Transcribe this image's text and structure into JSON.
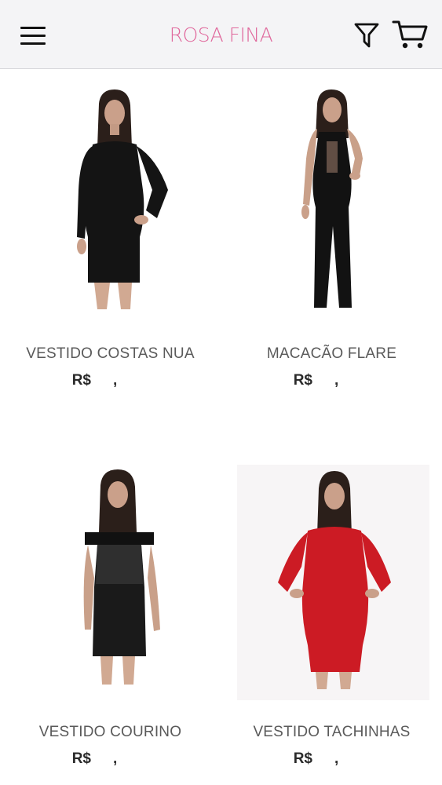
{
  "header": {
    "brand": "ROSA FINA",
    "icons": {
      "menu": "menu-icon",
      "filter": "filter-icon",
      "cart": "cart-icon"
    },
    "brand_color": "#e0689c"
  },
  "products": [
    {
      "name": "VESTIDO COSTAS NUA",
      "currency": "R$",
      "price_sep": ","
    },
    {
      "name": "MACACÃO FLARE",
      "currency": "R$",
      "price_sep": ","
    },
    {
      "name": "VESTIDO COURINO",
      "currency": "R$",
      "price_sep": ","
    },
    {
      "name": "VESTIDO TACHINHAS",
      "currency": "R$",
      "price_sep": ","
    }
  ]
}
